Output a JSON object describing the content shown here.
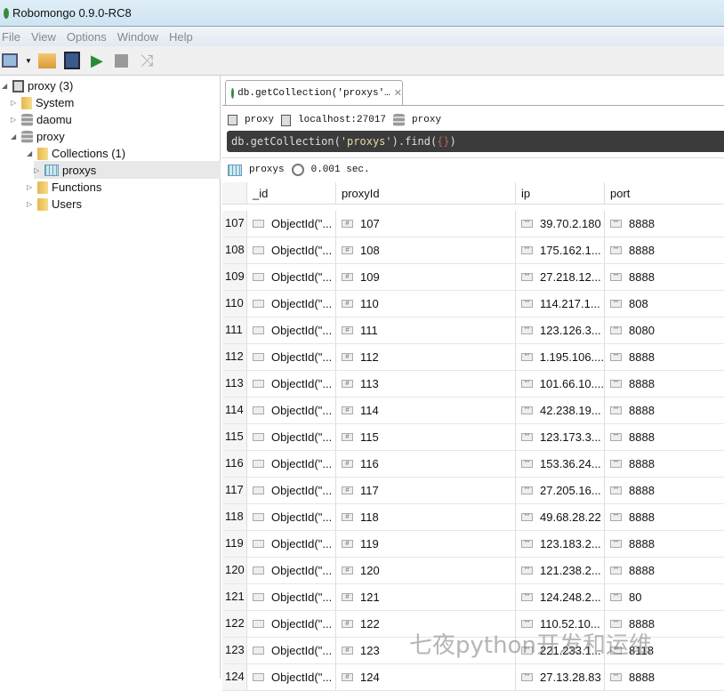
{
  "window": {
    "title": "Robomongo 0.9.0-RC8"
  },
  "menu": [
    "File",
    "View",
    "Options",
    "Window",
    "Help"
  ],
  "tree": {
    "server": "proxy (3)",
    "system": "System",
    "db1": "daomu",
    "db2": "proxy",
    "collections": "Collections (1)",
    "collection": "proxys",
    "functions": "Functions",
    "users": "Users"
  },
  "tab": {
    "label": "db.getCollection('proxys'…"
  },
  "info": {
    "connection": "proxy",
    "host": "localhost:27017",
    "database": "proxy"
  },
  "query": {
    "prefix": "db.getCollection(",
    "arg": "'proxys'",
    "mid": ").find(",
    "braces": "{}",
    "suffix": ")"
  },
  "stats": {
    "collection": "proxys",
    "time": "0.001 sec."
  },
  "columns": [
    "_id",
    "proxyId",
    "ip",
    "port"
  ],
  "rows": [
    {
      "n": "107",
      "id": "ObjectId(\"...",
      "proxyId": "107",
      "ip": "39.70.2.180",
      "port": "8888"
    },
    {
      "n": "108",
      "id": "ObjectId(\"...",
      "proxyId": "108",
      "ip": "175.162.1...",
      "port": "8888"
    },
    {
      "n": "109",
      "id": "ObjectId(\"...",
      "proxyId": "109",
      "ip": "27.218.12...",
      "port": "8888"
    },
    {
      "n": "110",
      "id": "ObjectId(\"...",
      "proxyId": "110",
      "ip": "114.217.1...",
      "port": "808"
    },
    {
      "n": "111",
      "id": "ObjectId(\"...",
      "proxyId": "111",
      "ip": "123.126.3...",
      "port": "8080"
    },
    {
      "n": "112",
      "id": "ObjectId(\"...",
      "proxyId": "112",
      "ip": "1.195.106....",
      "port": "8888"
    },
    {
      "n": "113",
      "id": "ObjectId(\"...",
      "proxyId": "113",
      "ip": "101.66.10....",
      "port": "8888"
    },
    {
      "n": "114",
      "id": "ObjectId(\"...",
      "proxyId": "114",
      "ip": "42.238.19...",
      "port": "8888"
    },
    {
      "n": "115",
      "id": "ObjectId(\"...",
      "proxyId": "115",
      "ip": "123.173.3...",
      "port": "8888"
    },
    {
      "n": "116",
      "id": "ObjectId(\"...",
      "proxyId": "116",
      "ip": "153.36.24...",
      "port": "8888"
    },
    {
      "n": "117",
      "id": "ObjectId(\"...",
      "proxyId": "117",
      "ip": "27.205.16...",
      "port": "8888"
    },
    {
      "n": "118",
      "id": "ObjectId(\"...",
      "proxyId": "118",
      "ip": "49.68.28.22",
      "port": "8888"
    },
    {
      "n": "119",
      "id": "ObjectId(\"...",
      "proxyId": "119",
      "ip": "123.183.2...",
      "port": "8888"
    },
    {
      "n": "120",
      "id": "ObjectId(\"...",
      "proxyId": "120",
      "ip": "121.238.2...",
      "port": "8888"
    },
    {
      "n": "121",
      "id": "ObjectId(\"...",
      "proxyId": "121",
      "ip": "124.248.2...",
      "port": "80"
    },
    {
      "n": "122",
      "id": "ObjectId(\"...",
      "proxyId": "122",
      "ip": "110.52.10...",
      "port": "8888"
    },
    {
      "n": "123",
      "id": "ObjectId(\"...",
      "proxyId": "123",
      "ip": "221.233.1...",
      "port": "8118"
    },
    {
      "n": "124",
      "id": "ObjectId(\"...",
      "proxyId": "124",
      "ip": "27.13.28.83",
      "port": "8888"
    }
  ],
  "watermark": "七夜python开发和运维"
}
